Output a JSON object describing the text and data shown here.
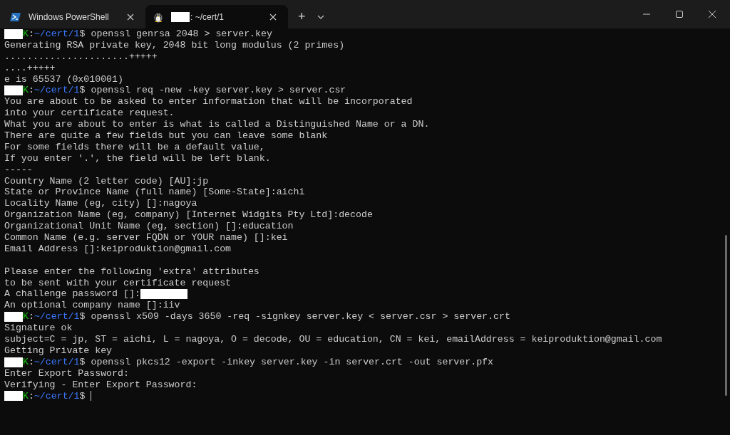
{
  "tabs": [
    {
      "label": "Windows PowerShell",
      "kind": "powershell",
      "selected": false,
      "redacted": false
    },
    {
      "label": ": ~/cert/1",
      "kind": "linux",
      "selected": true,
      "redacted": true
    }
  ],
  "new_tab": "+",
  "lines": [
    {
      "kind": "prompt",
      "host": "K",
      "sep": ":",
      "path": "~/cert/1",
      "symbol": "$",
      "command": "openssl genrsa 2048 > server.key"
    },
    {
      "kind": "output",
      "text": "Generating RSA private key, 2048 bit long modulus (2 primes)"
    },
    {
      "kind": "output",
      "text": "......................+++++"
    },
    {
      "kind": "output",
      "text": "....+++++"
    },
    {
      "kind": "output",
      "text": "e is 65537 (0x010001)"
    },
    {
      "kind": "prompt",
      "host": "K",
      "sep": ":",
      "path": "~/cert/1",
      "symbol": "$",
      "command": "openssl req -new -key server.key > server.csr"
    },
    {
      "kind": "output",
      "text": "You are about to be asked to enter information that will be incorporated"
    },
    {
      "kind": "output",
      "text": "into your certificate request."
    },
    {
      "kind": "output",
      "text": "What you are about to enter is what is called a Distinguished Name or a DN."
    },
    {
      "kind": "output",
      "text": "There are quite a few fields but you can leave some blank"
    },
    {
      "kind": "output",
      "text": "For some fields there will be a default value,"
    },
    {
      "kind": "output",
      "text": "If you enter '.', the field will be left blank."
    },
    {
      "kind": "output",
      "text": "-----"
    },
    {
      "kind": "output",
      "text": "Country Name (2 letter code) [AU]:jp"
    },
    {
      "kind": "output",
      "text": "State or Province Name (full name) [Some-State]:aichi"
    },
    {
      "kind": "output",
      "text": "Locality Name (eg, city) []:nagoya"
    },
    {
      "kind": "output",
      "text": "Organization Name (eg, company) [Internet Widgits Pty Ltd]:decode"
    },
    {
      "kind": "output",
      "text": "Organizational Unit Name (eg, section) []:education"
    },
    {
      "kind": "output",
      "text": "Common Name (e.g. server FQDN or YOUR name) []:kei"
    },
    {
      "kind": "output",
      "text": "Email Address []:keiproduktion@gmail.com"
    },
    {
      "kind": "blank"
    },
    {
      "kind": "output",
      "text": "Please enter the following 'extra' attributes"
    },
    {
      "kind": "output",
      "text": "to be sent with your certificate request"
    },
    {
      "kind": "secret",
      "text": "A challenge password []:"
    },
    {
      "kind": "output",
      "text": "An optional company name []:iiv"
    },
    {
      "kind": "prompt",
      "host": "K",
      "sep": ":",
      "path": "~/cert/1",
      "symbol": "$",
      "command": "openssl x509 -days 3650 -req -signkey server.key < server.csr > server.crt"
    },
    {
      "kind": "output",
      "text": "Signature ok"
    },
    {
      "kind": "output",
      "text": "subject=C = jp, ST = aichi, L = nagoya, O = decode, OU = education, CN = kei, emailAddress = keiproduktion@gmail.com"
    },
    {
      "kind": "output",
      "text": "Getting Private key"
    },
    {
      "kind": "prompt",
      "host": "K",
      "sep": ":",
      "path": "~/cert/1",
      "symbol": "$",
      "command": "openssl pkcs12 -export -inkey server.key -in server.crt -out server.pfx"
    },
    {
      "kind": "output",
      "text": "Enter Export Password:"
    },
    {
      "kind": "output",
      "text": "Verifying - Enter Export Password:"
    },
    {
      "kind": "prompt",
      "host": "K",
      "sep": ":",
      "path": "~/cert/1",
      "symbol": "$",
      "cursor": true
    }
  ]
}
